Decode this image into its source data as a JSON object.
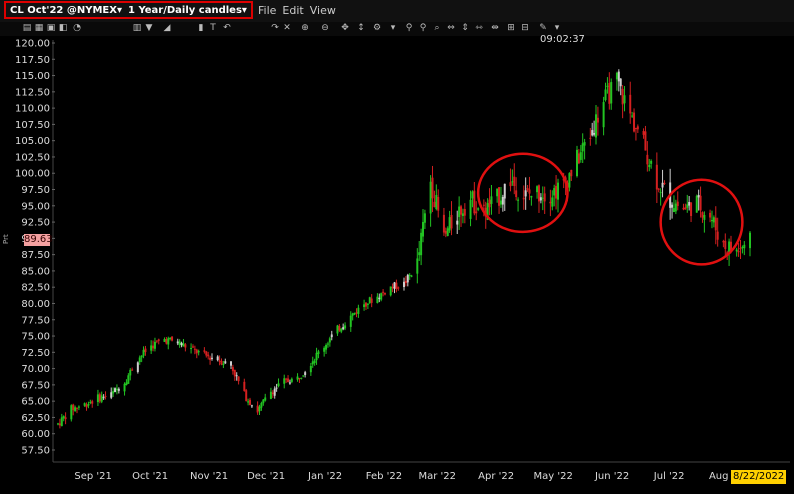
{
  "window": {
    "title_symbol": "CL Oct'22 @NYMEX",
    "title_period": "1 Year/Daily candles",
    "menus": [
      "File",
      "Edit",
      "View"
    ]
  },
  "toolbar": {
    "icons": [
      "open-icon",
      "save-icon",
      "print-icon",
      "copy-icon",
      "chart-icon",
      "table-icon",
      "draw-icon",
      "line-icon",
      "fib-icon",
      "text-icon",
      "undo-icon",
      "redo-icon",
      "cross-icon",
      "zoom-in-icon",
      "zoom-out-icon",
      "pan-icon",
      "measure-icon",
      "settings-icon",
      "more-icon"
    ]
  },
  "status": {
    "time": "09:02:37",
    "current_price": "89.63",
    "current_date": "8/22/2022",
    "y_axis_unit": "Prt"
  },
  "colors": {
    "up": "#22c422",
    "down": "#d42020",
    "neutral": "#cfcfcf",
    "highlight_circle": "#e01010"
  },
  "chart_data": {
    "type": "candlestick",
    "y_ticks": [
      "120.00",
      "117.50",
      "115.00",
      "112.50",
      "110.00",
      "107.50",
      "105.00",
      "102.50",
      "100.00",
      "97.50",
      "95.00",
      "92.50",
      "90.00",
      "87.50",
      "85.00",
      "82.50",
      "80.00",
      "77.50",
      "75.00",
      "72.50",
      "70.00",
      "67.50",
      "65.00",
      "62.50",
      "60.00",
      "57.50"
    ],
    "ylim": [
      55.0,
      121.0
    ],
    "x_ticks": [
      "Sep '21",
      "Oct '21",
      "Nov '21",
      "Dec '21",
      "Jan '22",
      "Feb '22",
      "Mar '22",
      "Apr '22",
      "May '22",
      "Jun '22",
      "Jul '22",
      "Aug '22"
    ],
    "close_path": [
      [
        "2021-08-23",
        61.5
      ],
      [
        "2021-08-30",
        63.8
      ],
      [
        "2021-09-06",
        64.5
      ],
      [
        "2021-09-13",
        65.5
      ],
      [
        "2021-09-20",
        66.0
      ],
      [
        "2021-09-27",
        68.0
      ],
      [
        "2021-10-04",
        71.5
      ],
      [
        "2021-10-11",
        73.5
      ],
      [
        "2021-10-18",
        74.5
      ],
      [
        "2021-10-25",
        74.0
      ],
      [
        "2021-11-01",
        73.0
      ],
      [
        "2021-11-08",
        72.0
      ],
      [
        "2021-11-15",
        71.5
      ],
      [
        "2021-11-22",
        70.5
      ],
      [
        "2021-11-29",
        66.0
      ],
      [
        "2021-12-06",
        63.5
      ],
      [
        "2021-12-13",
        66.5
      ],
      [
        "2021-12-20",
        68.0
      ],
      [
        "2021-12-27",
        68.5
      ],
      [
        "2022-01-03",
        71.0
      ],
      [
        "2022-01-10",
        73.5
      ],
      [
        "2022-01-17",
        76.0
      ],
      [
        "2022-01-24",
        78.0
      ],
      [
        "2022-01-31",
        80.0
      ],
      [
        "2022-02-07",
        81.0
      ],
      [
        "2022-02-14",
        82.5
      ],
      [
        "2022-02-21",
        83.0
      ],
      [
        "2022-02-28",
        86.0
      ],
      [
        "2022-03-07",
        99.0
      ],
      [
        "2022-03-14",
        90.0
      ],
      [
        "2022-03-21",
        94.0
      ],
      [
        "2022-03-28",
        96.0
      ],
      [
        "2022-04-04",
        94.0
      ],
      [
        "2022-04-11",
        96.0
      ],
      [
        "2022-04-18",
        99.0
      ],
      [
        "2022-04-25",
        96.5
      ],
      [
        "2022-05-02",
        97.0
      ],
      [
        "2022-05-09",
        97.0
      ],
      [
        "2022-05-16",
        98.0
      ],
      [
        "2022-05-23",
        102.0
      ],
      [
        "2022-05-30",
        106.0
      ],
      [
        "2022-06-06",
        111.0
      ],
      [
        "2022-06-13",
        114.0
      ],
      [
        "2022-06-20",
        109.0
      ],
      [
        "2022-06-27",
        104.5
      ],
      [
        "2022-07-04",
        99.0
      ],
      [
        "2022-07-11",
        96.0
      ],
      [
        "2022-07-18",
        94.5
      ],
      [
        "2022-07-25",
        95.5
      ],
      [
        "2022-08-01",
        93.5
      ],
      [
        "2022-08-08",
        89.0
      ],
      [
        "2022-08-15",
        88.0
      ],
      [
        "2022-08-22",
        89.6
      ]
    ],
    "annotations": [
      {
        "shape": "ellipse",
        "from": "2022-04-01",
        "to": "2022-05-18",
        "low": 91.0,
        "high": 103.0
      },
      {
        "shape": "ellipse",
        "from": "2022-07-06",
        "to": "2022-08-18",
        "low": 86.0,
        "high": 99.0
      }
    ]
  }
}
